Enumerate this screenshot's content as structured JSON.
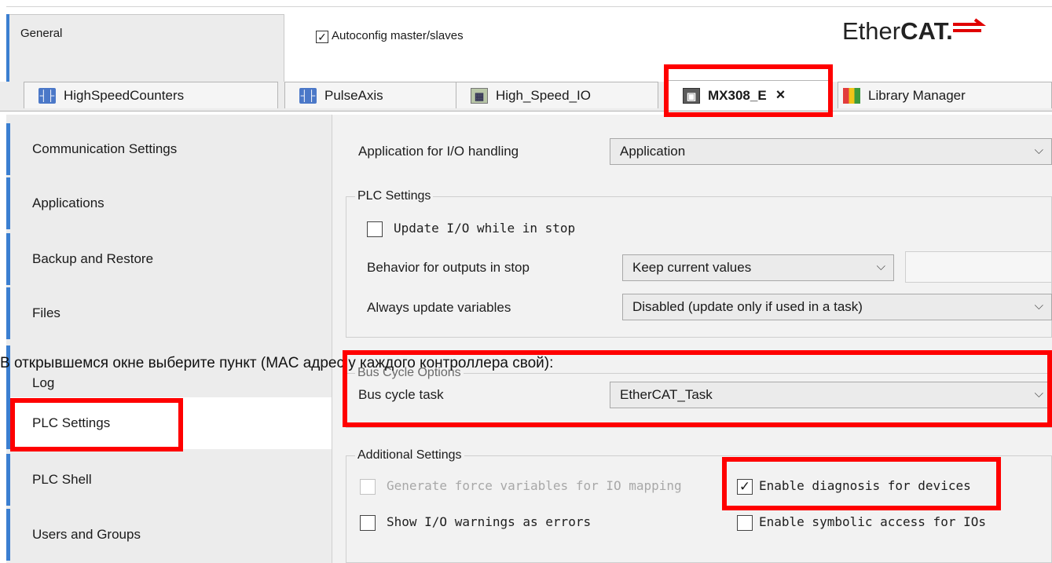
{
  "header": {
    "general_tab": "General",
    "autoconfig_label": "Autoconfig master/slaves",
    "autoconfig_checked": "✓",
    "logo_part1": "Ether",
    "logo_part2": "CAT."
  },
  "tabs": [
    {
      "label": "HighSpeedCounters",
      "icon": "ih"
    },
    {
      "label": "PulseAxis",
      "icon": "ih"
    },
    {
      "label": "High_Speed_IO",
      "icon": "io"
    },
    {
      "label": "MX308_E",
      "icon": "dev",
      "close": "×"
    },
    {
      "label": "Library Manager",
      "icon": "lib"
    }
  ],
  "sidebar": {
    "items": [
      "Communication Settings",
      "Applications",
      "Backup and Restore",
      "Files",
      "Log",
      "PLC Settings",
      "PLC Shell",
      "Users and Groups"
    ]
  },
  "settings": {
    "app_label": "Application for I/O handling",
    "app_value": "Application",
    "plc_group": "PLC Settings",
    "update_io_label": "Update I/O while in stop",
    "behavior_label": "Behavior for outputs in stop",
    "behavior_value": "Keep current values",
    "always_label": "Always update variables",
    "always_value": "Disabled (update only if used in a task)",
    "bus_group": "Bus Cycle Options",
    "bus_label": "Bus cycle task",
    "bus_value": "EtherCAT_Task",
    "additional_group": "Additional Settings",
    "force_label": "Generate force variables for IO mapping",
    "diag_label": "Enable diagnosis for devices",
    "diag_checked": "✓",
    "warnings_label": "Show I/O warnings as errors",
    "symbolic_label": "Enable symbolic access for IOs",
    "arrow": "⌵"
  },
  "caption": "В открывшемся окне выберите пункт (MAC адрес у каждого контроллера свой):",
  "colors": {
    "accent": "#3b7fd1",
    "highlight": "#ff0000"
  }
}
